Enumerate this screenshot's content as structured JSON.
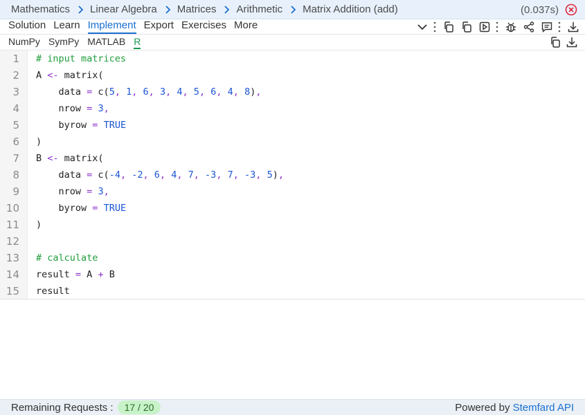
{
  "breadcrumb": [
    "Mathematics",
    "Linear Algebra",
    "Matrices",
    "Arithmetic",
    "Matrix Addition (add)"
  ],
  "timing": "(0.037s)",
  "tabs": [
    {
      "label": "Solution",
      "active": false
    },
    {
      "label": "Learn",
      "active": false
    },
    {
      "label": "Implement",
      "active": true
    },
    {
      "label": "Export",
      "active": false
    },
    {
      "label": "Exercises",
      "active": false
    },
    {
      "label": "More",
      "active": false
    }
  ],
  "toolbar_icons": [
    "chevron-down-icon",
    "more-vertical-icon",
    "copy-icon",
    "copy-icon",
    "run-icon",
    "more-vertical-icon",
    "bug-icon",
    "share-icon",
    "comment-icon",
    "more-vertical-icon",
    "download-icon"
  ],
  "languages": [
    {
      "label": "NumPy",
      "active": false
    },
    {
      "label": "SymPy",
      "active": false
    },
    {
      "label": "MATLAB",
      "active": false
    },
    {
      "label": "R",
      "active": true
    }
  ],
  "code_lines": [
    {
      "n": "1",
      "text": "# input matrices"
    },
    {
      "n": "2",
      "text": "A <- matrix("
    },
    {
      "n": "3",
      "text": "    data = c(5, 1, 6, 3, 4, 5, 6, 4, 8),"
    },
    {
      "n": "4",
      "text": "    nrow = 3,"
    },
    {
      "n": "5",
      "text": "    byrow = TRUE"
    },
    {
      "n": "6",
      "text": ")"
    },
    {
      "n": "7",
      "text": "B <- matrix("
    },
    {
      "n": "8",
      "text": "    data = c(-4, -2, 6, 4, 7, -3, 7, -3, 5),"
    },
    {
      "n": "9",
      "text": "    nrow = 3,"
    },
    {
      "n": "10",
      "text": "    byrow = TRUE"
    },
    {
      "n": "11",
      "text": ")"
    },
    {
      "n": "12",
      "text": ""
    },
    {
      "n": "13",
      "text": "# calculate"
    },
    {
      "n": "14",
      "text": "result = A + B"
    },
    {
      "n": "15",
      "text": "result"
    }
  ],
  "status": {
    "remaining_label": "Remaining Requests :",
    "remaining_value": "17 / 20",
    "powered_prefix": "Powered by",
    "powered_link": "Stemfard API"
  },
  "colors": {
    "accent": "#1a6fd1",
    "active_language": "#1a9850",
    "comment": "#1f9e3c",
    "number": "#1a55d4",
    "operator": "#8b2fc9",
    "close": "#e0263b"
  }
}
